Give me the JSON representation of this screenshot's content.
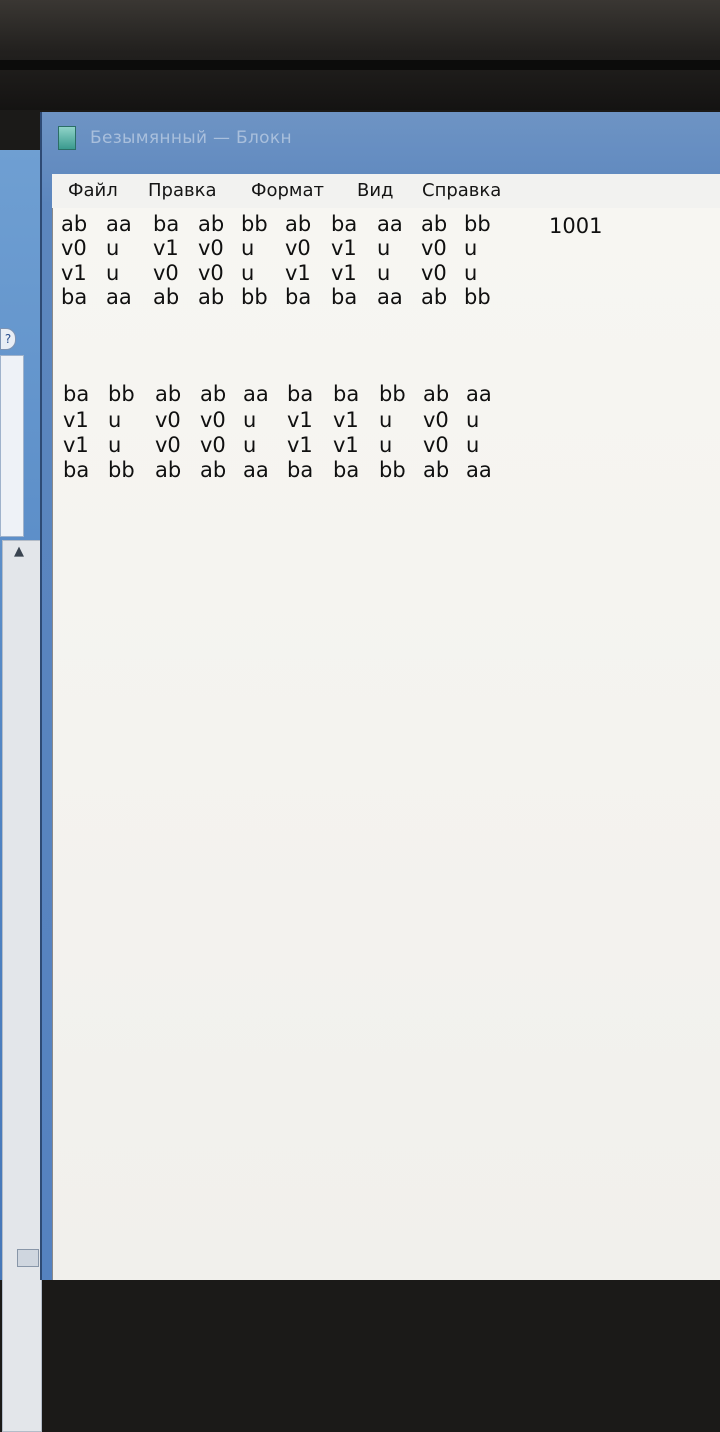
{
  "window": {
    "title": "Безымянный — Блокн",
    "icon": "notepad-icon"
  },
  "menu": {
    "items": [
      "Файл",
      "Правка",
      "Формат",
      "Вид",
      "Справка"
    ]
  },
  "editor": {
    "block1": [
      [
        "ab",
        "aa",
        "ba",
        "ab",
        "bb",
        "ab",
        "ba",
        "aa",
        "ab",
        "bb"
      ],
      [
        "v0",
        "u",
        "v1",
        "v0",
        "u",
        "v0",
        "v1",
        "u",
        "v0",
        "u"
      ],
      [
        "v1",
        "u",
        "v0",
        "v0",
        "u",
        "v1",
        "v1",
        "u",
        "v0",
        "u"
      ],
      [
        "ba",
        "aa",
        "ab",
        "ab",
        "bb",
        "ba",
        "ba",
        "aa",
        "ab",
        "bb"
      ]
    ],
    "block1_extra": "1001",
    "block2": [
      [
        "ba",
        "bb",
        "ab",
        "ab",
        "aa",
        "ba",
        "ba",
        "bb",
        "ab",
        "aa"
      ],
      [
        "v1",
        "u",
        "v0",
        "v0",
        "u",
        "v1",
        "v1",
        "u",
        "v0",
        "u"
      ],
      [
        "v1",
        "u",
        "v0",
        "v0",
        "u",
        "v1",
        "v1",
        "u",
        "v0",
        "u"
      ],
      [
        "ba",
        "bb",
        "ab",
        "ab",
        "aa",
        "ba",
        "ba",
        "bb",
        "ab",
        "aa"
      ]
    ]
  },
  "left_window": {
    "help_icon": "help-icon",
    "scroll_up": "▲"
  },
  "colors": {
    "title_bar": "#5c86be",
    "menu_bg": "#f2f2f0",
    "editor_bg": "#f5f4f0",
    "text": "#101010"
  }
}
